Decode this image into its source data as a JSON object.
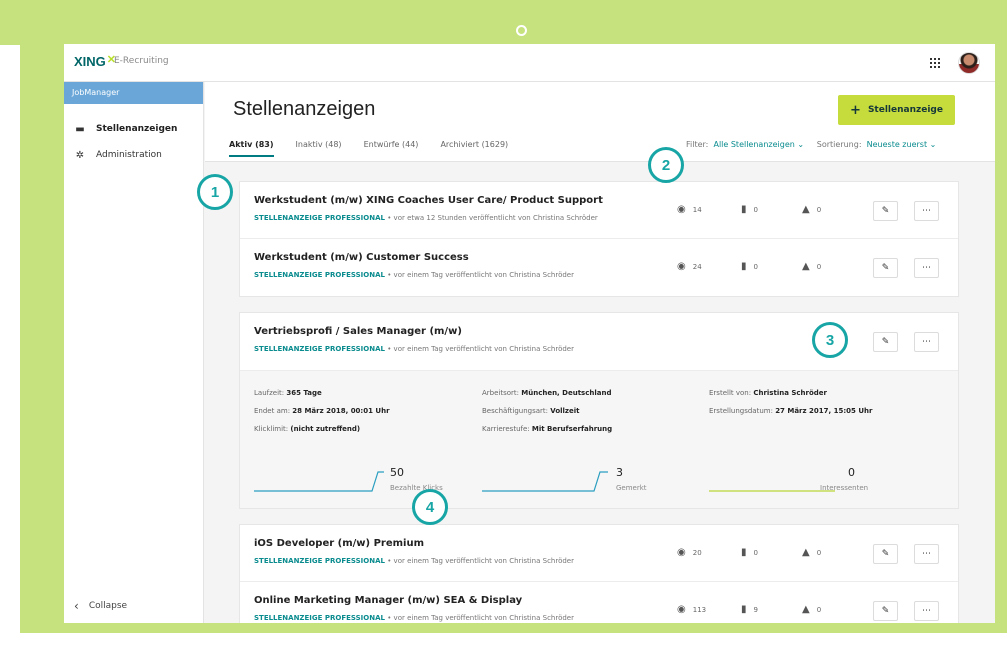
{
  "app": {
    "logo": "XING",
    "logo_sub": "E-Recruiting"
  },
  "colors": {
    "brand_green": "#c6e27f",
    "accent_teal": "#0a8b8e",
    "button_lime": "#c6dc3c",
    "sidebar_header_blue": "#6aa7d8"
  },
  "sidebar": {
    "header": "JobManager",
    "items": [
      {
        "label": "Stellenanzeigen",
        "icon": "monitor-icon"
      },
      {
        "label": "Administration",
        "icon": "gear-icon"
      }
    ],
    "collapse": "Collapse"
  },
  "header": {
    "title": "Stellenanzeigen",
    "add_button": "Stellenanzeige"
  },
  "tabs": [
    {
      "label": "Aktiv (83)",
      "active": true
    },
    {
      "label": "Inaktiv (48)",
      "active": false
    },
    {
      "label": "Entwürfe (44)",
      "active": false
    },
    {
      "label": "Archiviert (1629)",
      "active": false
    }
  ],
  "filters": {
    "filter_label": "Filter:",
    "filter_value": "Alle Stellenanzeigen",
    "sort_label": "Sortierung:",
    "sort_value": "Neueste zuerst"
  },
  "jobs_group1": [
    {
      "title": "Werkstudent (m/w) XING Coaches User Care/ Product Support",
      "tag": "STELLENANZEIGE PROFESSIONAL",
      "meta": " • vor etwa 12 Stunden veröffentlicht von Christina Schröder",
      "views": "14",
      "bookmarks": "0",
      "likes": "0"
    },
    {
      "title": "Werkstudent (m/w) Customer Success",
      "tag": "STELLENANZEIGE PROFESSIONAL",
      "meta": " • vor einem Tag veröffentlicht von Christina Schröder",
      "views": "24",
      "bookmarks": "0",
      "likes": "0"
    }
  ],
  "expanded_job": {
    "title": "Vertriebsprofi / Sales Manager (m/w)",
    "tag": "STELLENANZEIGE PROFESSIONAL",
    "meta": " • vor einem Tag veröffentlicht von Christina Schröder",
    "details": {
      "laufzeit_label": "Laufzeit:",
      "laufzeit": "365 Tage",
      "endet_label": "Endet am:",
      "endet": "28 März 2018, 00:01 Uhr",
      "klicklimit_label": "Klicklimit:",
      "klicklimit": "(nicht zutreffend)",
      "arbeitsort_label": "Arbeitsort:",
      "arbeitsort": "München, Deutschland",
      "beschaeftigung_label": "Beschäftigungsart:",
      "beschaeftigung": "Vollzeit",
      "karriere_label": "Karrierestufe:",
      "karriere": "Mit Berufserfahrung",
      "erstellt_von_label": "Erstellt von:",
      "erstellt_von": "Christina Schröder",
      "erstellungsdatum_label": "Erstellungsdatum:",
      "erstellungsdatum": "27 März 2017, 15:05 Uhr"
    },
    "metrics": [
      {
        "value": "50",
        "label": "Bezahlte Klicks"
      },
      {
        "value": "3",
        "label": "Gemerkt"
      },
      {
        "value": "0",
        "label": "Interessenten"
      }
    ]
  },
  "jobs_group2": [
    {
      "title": "iOS Developer (m/w) Premium",
      "tag": "STELLENANZEIGE PROFESSIONAL",
      "meta": " • vor einem Tag veröffentlicht von Christina Schröder",
      "views": "20",
      "bookmarks": "0",
      "likes": "0"
    },
    {
      "title": "Online Marketing Manager (m/w) SEA & Display",
      "tag": "STELLENANZEIGE PROFESSIONAL",
      "meta": " • vor einem Tag veröffentlicht von Christina Schröder",
      "views": "113",
      "bookmarks": "9",
      "likes": "0"
    }
  ],
  "badges": [
    "1",
    "2",
    "3",
    "4"
  ]
}
